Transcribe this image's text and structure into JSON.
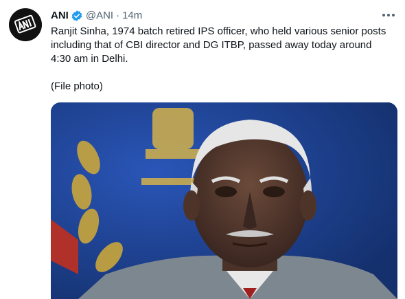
{
  "account": {
    "name": "ANI",
    "handle": "@ANI",
    "separator": "·",
    "time": "14m",
    "avatar_text": "ANI",
    "verified": true
  },
  "tweet": {
    "text_line1": "Ranjit Sinha, 1974 batch retired IPS officer, who held various senior posts including that of CBI director and DG ITBP, passed away today around 4:30 am in Delhi.",
    "text_line2": "(File photo)"
  },
  "media": {
    "icon": "photo-of-man-in-front-of-emblem",
    "background_color": "#1d3d8a"
  },
  "colors": {
    "accent": "#1d9bf0",
    "secondary_text": "#536471",
    "primary_text": "#0f1419"
  }
}
